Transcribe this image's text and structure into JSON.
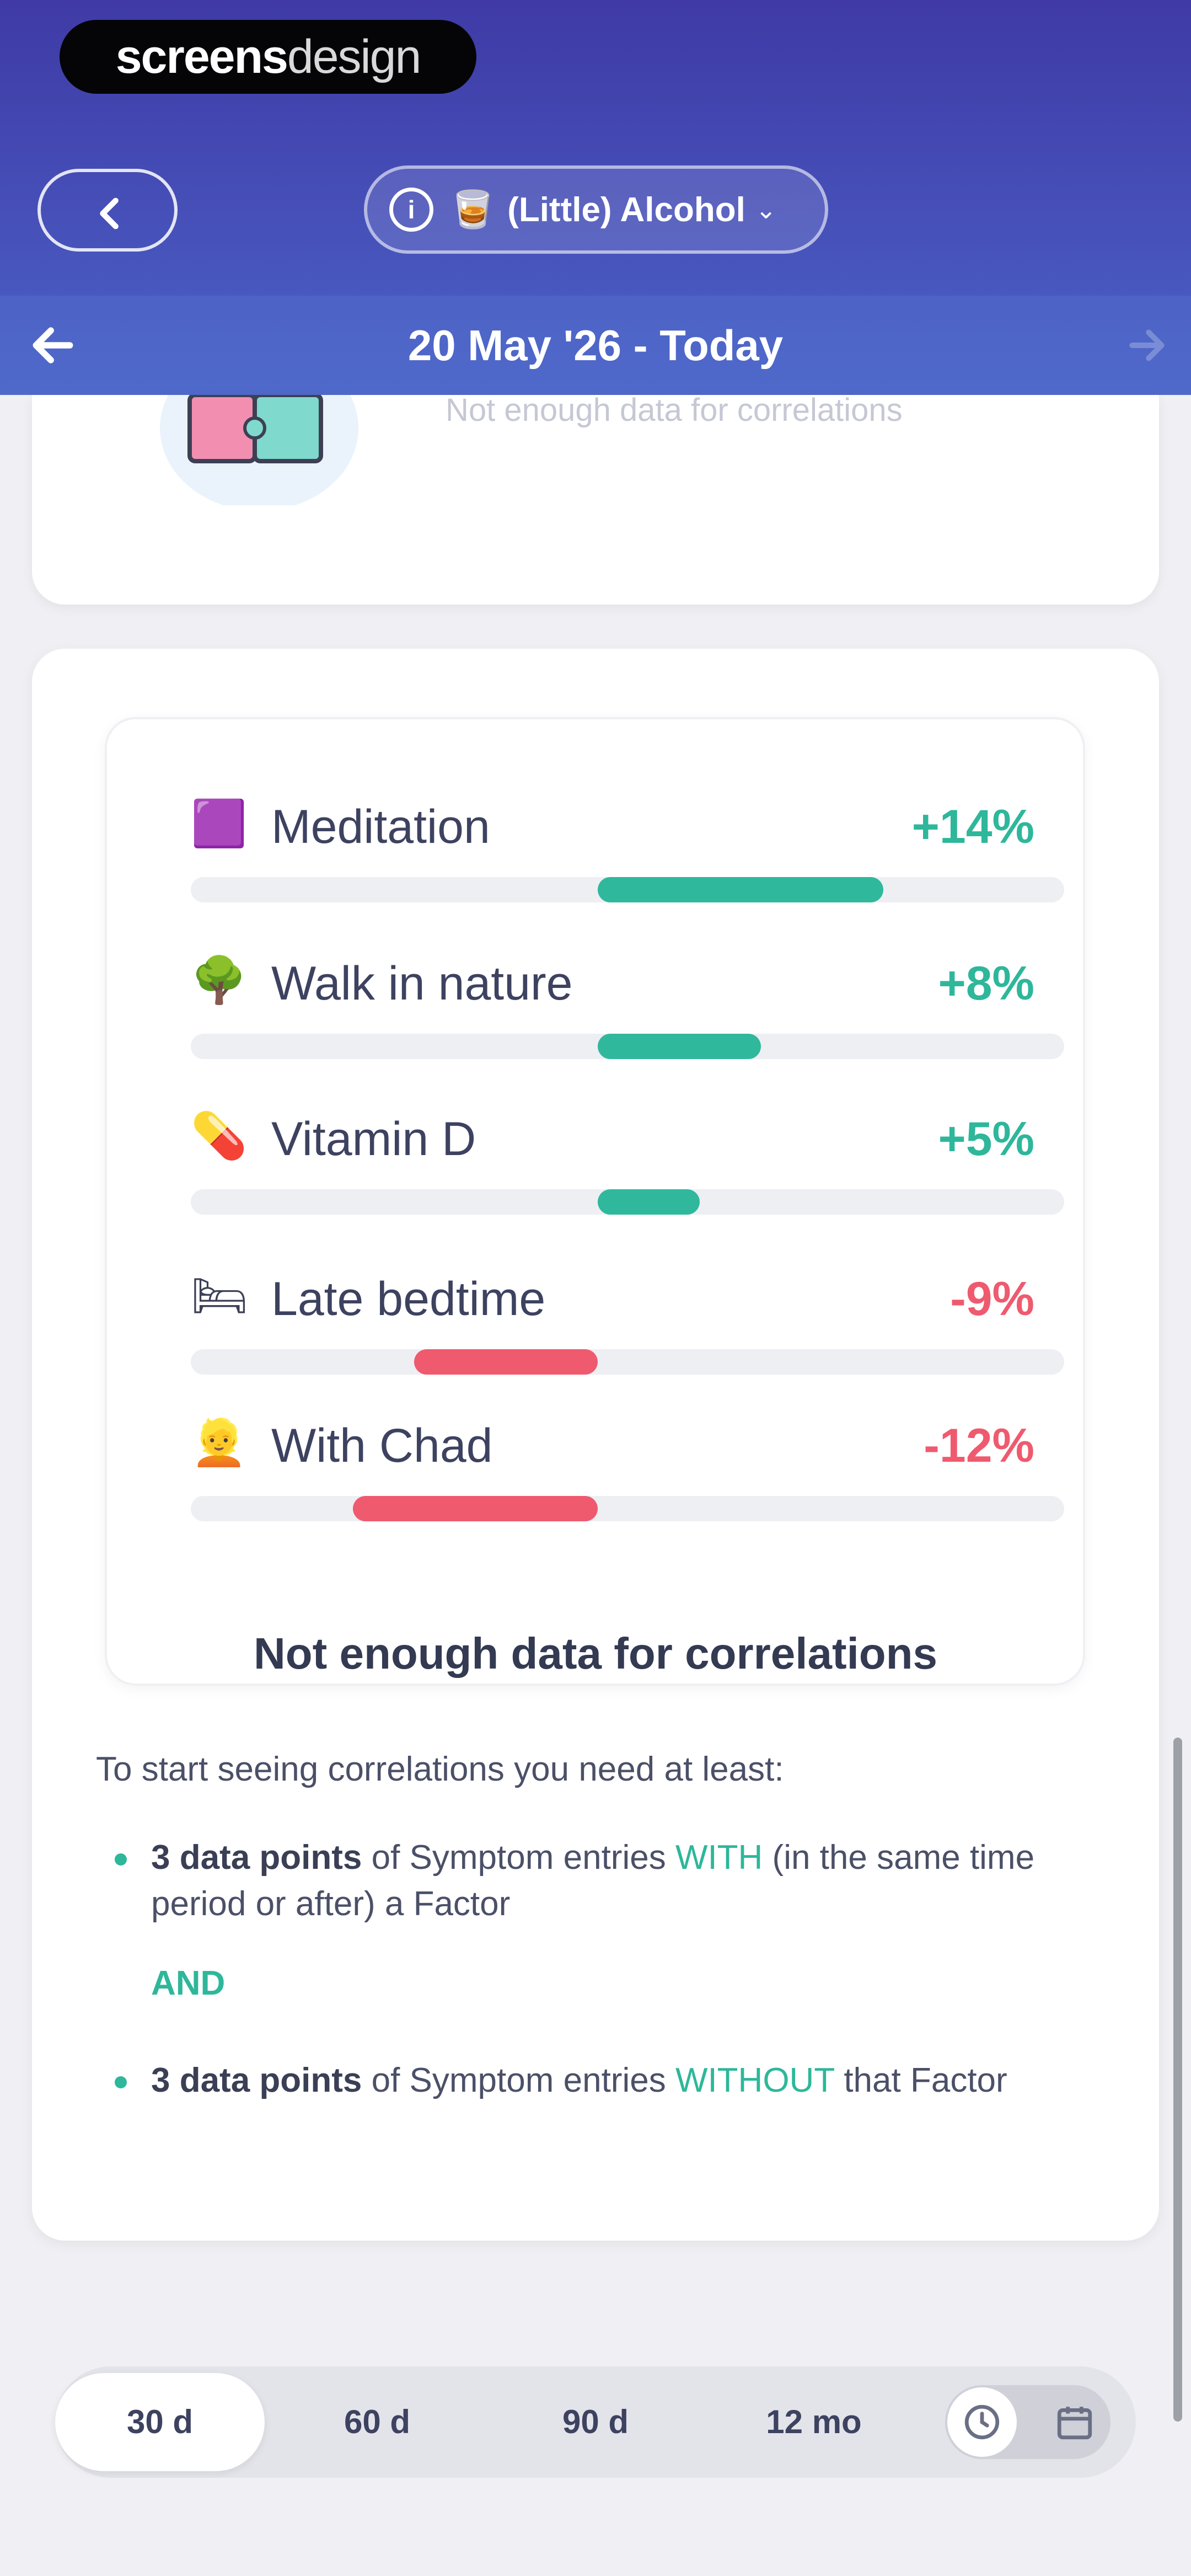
{
  "watermark": {
    "bold": "screens",
    "light": "design"
  },
  "header": {
    "factor_selector": {
      "emoji": "🥃",
      "label": "(Little) Alcohol",
      "chevron": "⌄",
      "info": "i"
    },
    "date_range": "20 May '26 - Today"
  },
  "top_card": {
    "text": "Not enough data for correlations"
  },
  "factors": [
    {
      "icon": "meditation-icon",
      "emoji": "🟪",
      "name": "Meditation",
      "pct": "+14%",
      "value": 14,
      "sign": "pos"
    },
    {
      "icon": "tree-icon",
      "emoji": "🌳",
      "name": "Walk in nature",
      "pct": "+8%",
      "value": 8,
      "sign": "pos"
    },
    {
      "icon": "pill-icon",
      "emoji": "💊",
      "name": "Vitamin D",
      "pct": "+5%",
      "value": 5,
      "sign": "pos"
    },
    {
      "icon": "bed-icon",
      "emoji": "🛏",
      "name": "Late bedtime",
      "pct": "-9%",
      "value": -9,
      "sign": "neg"
    },
    {
      "icon": "person-icon",
      "emoji": "👱",
      "name": "With Chad",
      "pct": "-12%",
      "value": -12,
      "sign": "neg"
    }
  ],
  "not_enough": {
    "title": "Not enough data for correlations",
    "intro": "To start seeing correlations you need at least:",
    "bullet1": {
      "bold": "3 data points",
      "pre": " of Symptom entries ",
      "highlight": "WITH",
      "post": " (in the same time period or after) a Factor"
    },
    "and": "AND",
    "bullet2": {
      "bold": "3 data points",
      "pre": " of Symptom entries ",
      "highlight": "WITHOUT",
      "post": " that Factor"
    }
  },
  "range": {
    "options": [
      "30 d",
      "60 d",
      "90 d",
      "12 mo"
    ],
    "active": "30 d"
  },
  "colors": {
    "positive": "#30b89d",
    "negative": "#ef5a6f",
    "header": "#4650b8"
  }
}
